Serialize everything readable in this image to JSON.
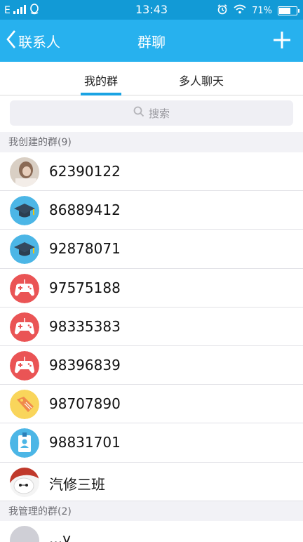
{
  "status_bar": {
    "network": "E",
    "time": "13:43",
    "battery": "71%",
    "battery_level": 0.71
  },
  "nav": {
    "back_label": "联系人",
    "title": "群聊"
  },
  "tabs": [
    {
      "label": "我的群",
      "selected": true
    },
    {
      "label": "多人聊天",
      "selected": false
    }
  ],
  "search": {
    "placeholder": "搜索"
  },
  "sections": {
    "created": "我创建的群(9)",
    "managed": "我管理的群(2)"
  },
  "groups": [
    {
      "name": "62390122",
      "icon": "photo-avatar"
    },
    {
      "name": "86889412",
      "icon": "graduation-cap-icon"
    },
    {
      "name": "92878071",
      "icon": "graduation-cap-icon"
    },
    {
      "name": "97575188",
      "icon": "gamepad-icon"
    },
    {
      "name": "98335383",
      "icon": "gamepad-icon"
    },
    {
      "name": "98396839",
      "icon": "gamepad-icon"
    },
    {
      "name": "98707890",
      "icon": "price-tag-icon"
    },
    {
      "name": "98831701",
      "icon": "id-badge-icon"
    },
    {
      "name": "汽修三班",
      "icon": "robot-avatar"
    }
  ],
  "partial_group": {
    "name": "...y"
  },
  "colors": {
    "status_bar": "#129ad6",
    "nav_bar": "#27b1ee",
    "accent": "#1aa3e3"
  }
}
